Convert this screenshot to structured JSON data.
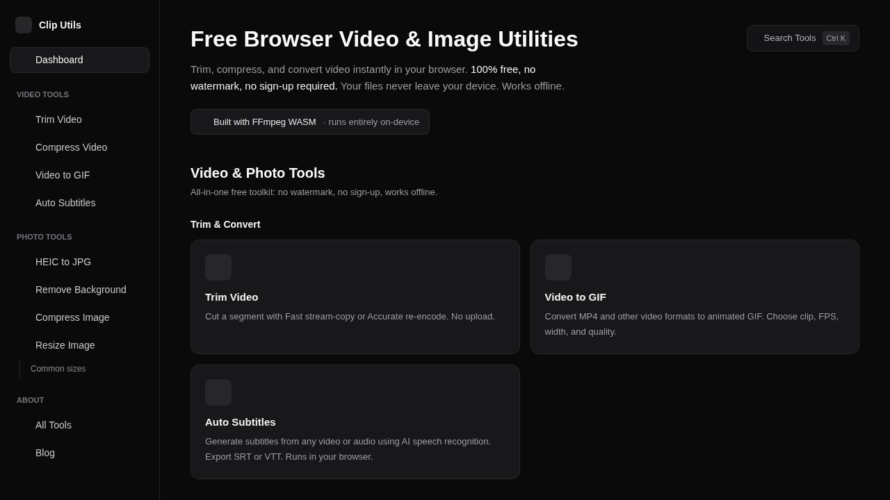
{
  "sidebar": {
    "brand": "Clip Utils",
    "top_items": [
      {
        "label": "Dashboard",
        "selected": true
      }
    ],
    "sections": [
      {
        "heading": "VIDEO TOOLS",
        "items": [
          {
            "label": "Trim Video",
            "selected": false
          },
          {
            "label": "Compress Video",
            "selected": false
          },
          {
            "label": "Video to GIF",
            "selected": false
          },
          {
            "label": "Auto Subtitles",
            "selected": false
          }
        ]
      },
      {
        "heading": "PHOTO TOOLS",
        "items": [
          {
            "label": "HEIC to JPG",
            "selected": false
          },
          {
            "label": "Remove Background",
            "selected": false
          },
          {
            "label": "Compress Image",
            "selected": false
          },
          {
            "label": "Resize Image",
            "selected": false,
            "children": [
              {
                "label": "Common sizes",
                "selected": false
              }
            ]
          }
        ]
      },
      {
        "heading": "ABOUT",
        "items": [
          {
            "label": "All Tools",
            "selected": false
          },
          {
            "label": "Blog",
            "selected": false
          }
        ]
      }
    ]
  },
  "header": {
    "title": "Free Browser Video & Image Utilities",
    "intro": "Trim, compress, and convert video instantly in your browser. **100% free, no watermark, no sign-up required.** Your files never leave your device. Works offline.",
    "badge": {
      "label": "Built with FFmpeg WASM",
      "note": "· runs entirely on-device"
    },
    "search": {
      "label": "Search Tools",
      "shortcut": "Ctrl K"
    }
  },
  "section": {
    "title": "Video & Photo Tools",
    "subtitle": "All-in-one free toolkit: no watermark, no sign-up, works offline.",
    "groups": [
      {
        "title": "Trim & Convert",
        "cards": [
          {
            "title": "Trim Video",
            "description": "Cut a segment with Fast stream-copy or Accurate re-encode. No upload."
          },
          {
            "title": "Video to GIF",
            "description": "Convert MP4 and other video formats to animated GIF. Choose clip, FPS, width, and quality."
          },
          {
            "title": "Auto Subtitles",
            "description": "Generate subtitles from any video or audio using AI speech recognition. Export SRT or VTT. Runs in your browser."
          }
        ]
      }
    ]
  }
}
